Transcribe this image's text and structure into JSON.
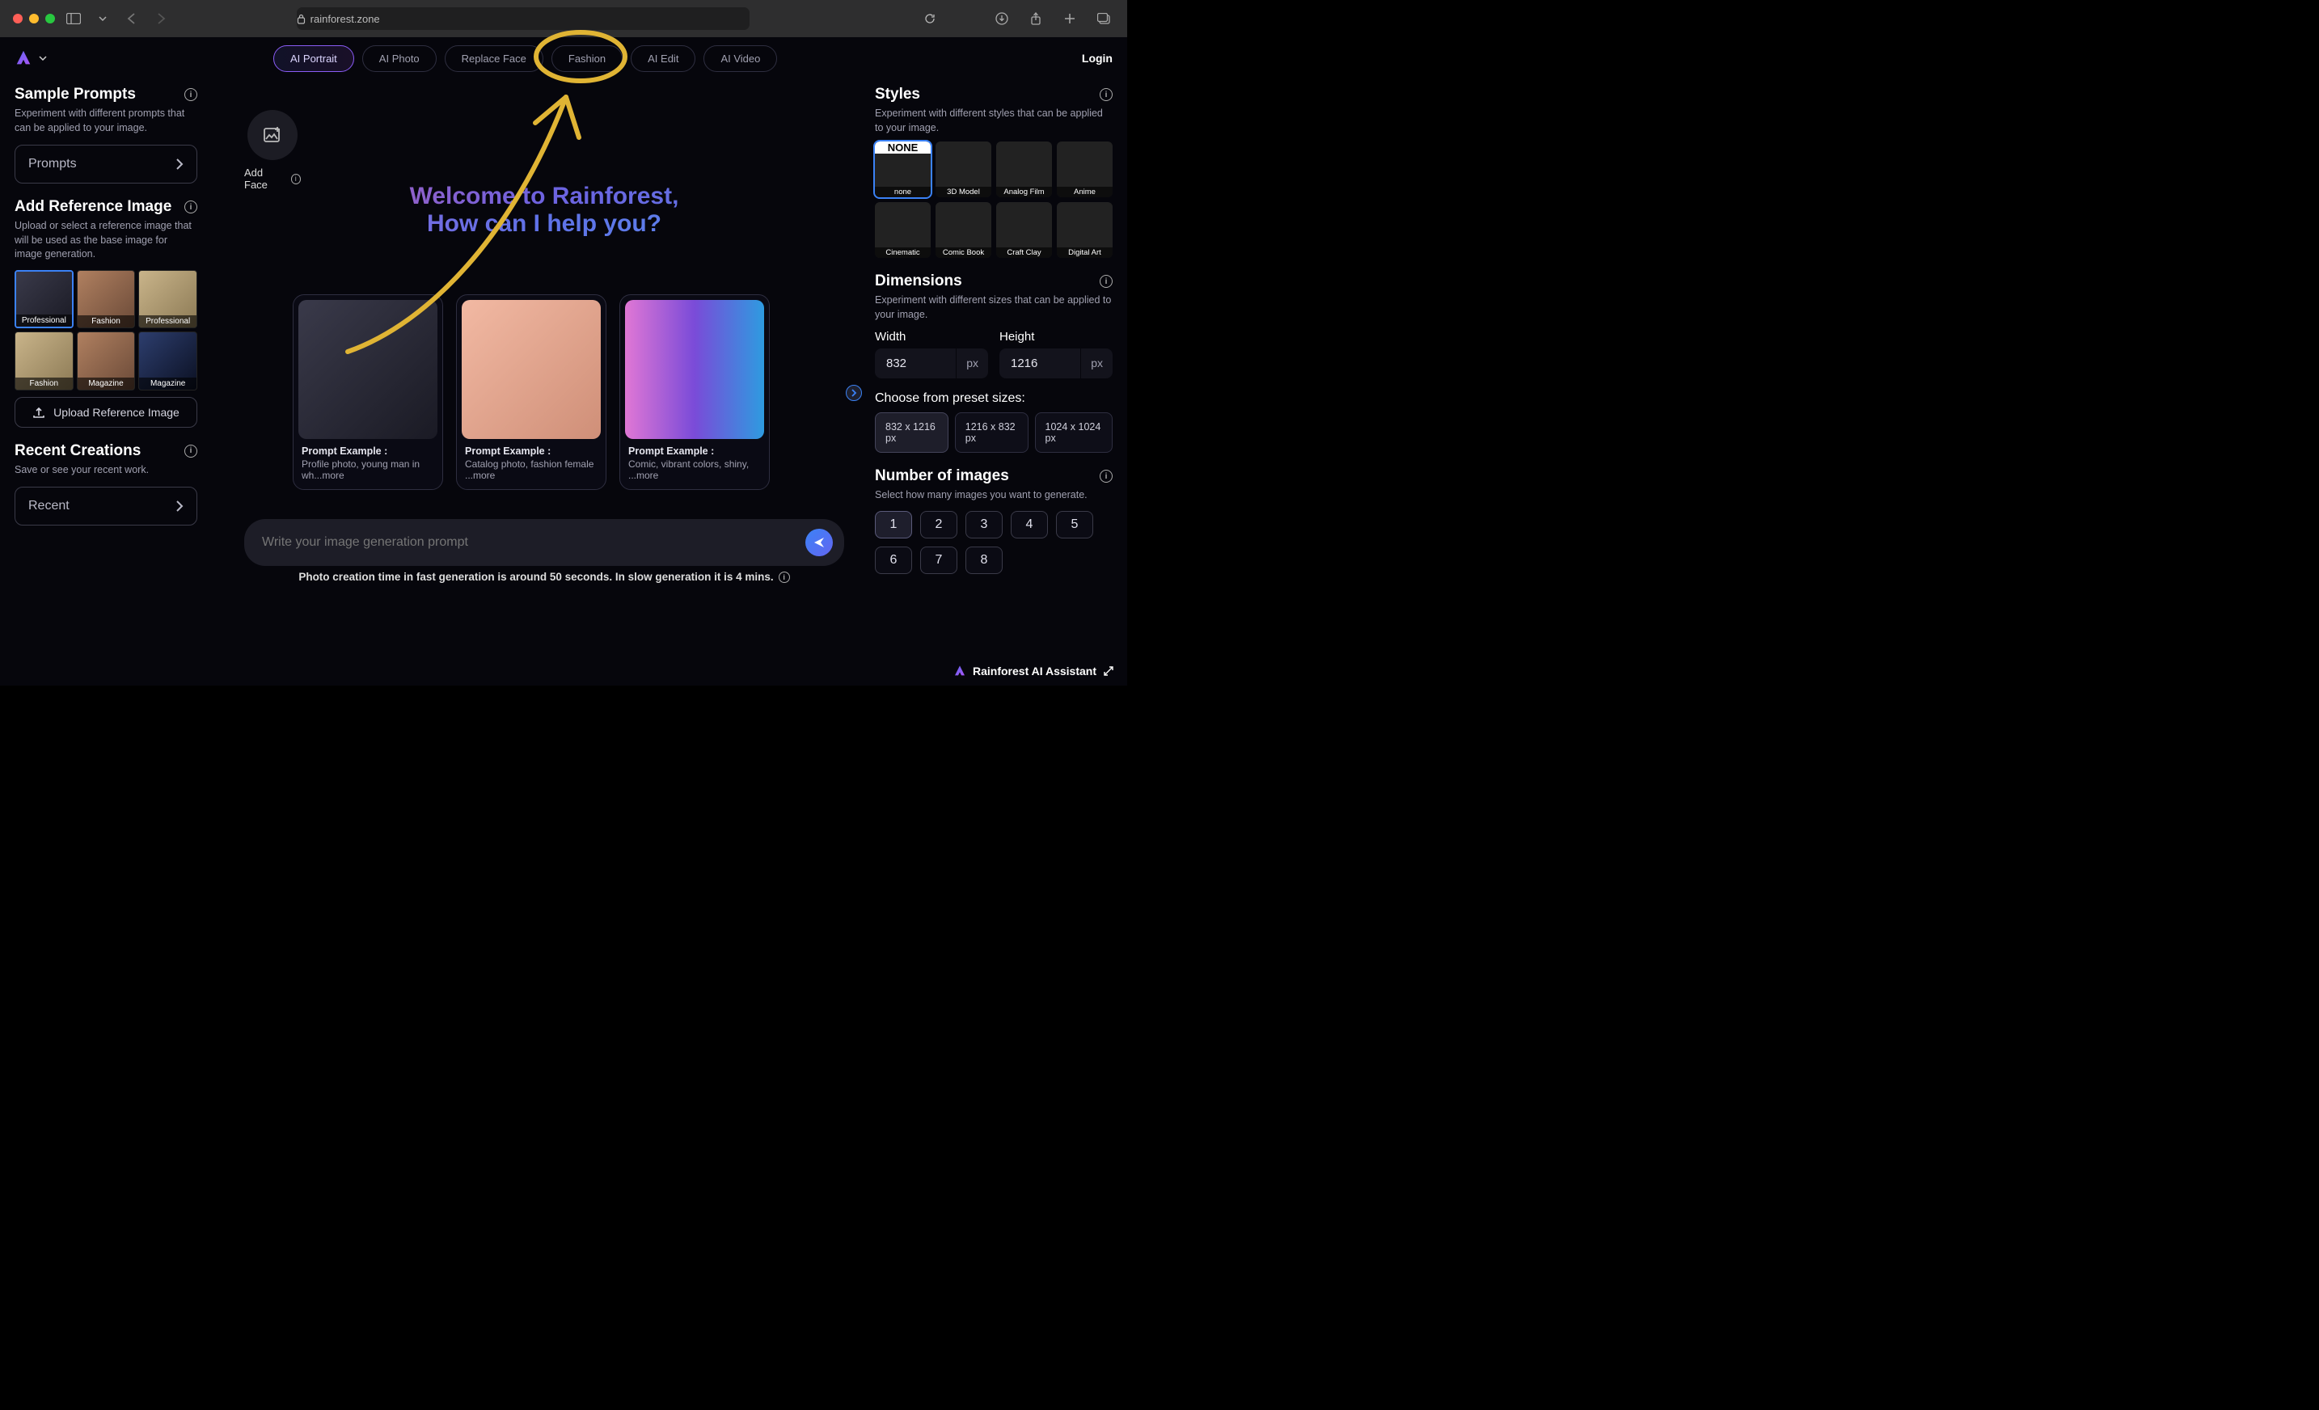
{
  "browser": {
    "url_host": "rainforest.zone"
  },
  "nav": {
    "items": [
      "AI Portrait",
      "AI Photo",
      "Replace Face",
      "Fashion",
      "AI Edit",
      "AI Video"
    ],
    "login": "Login"
  },
  "left": {
    "sample_title": "Sample Prompts",
    "sample_sub": "Experiment with different prompts that can be applied to your image.",
    "prompts_btn": "Prompts",
    "ref_title": "Add Reference Image",
    "ref_sub": "Upload or select a reference image that will be used as the base image for image generation.",
    "ref_images": [
      {
        "label": "Professional"
      },
      {
        "label": "Fashion"
      },
      {
        "label": "Professional"
      },
      {
        "label": "Fashion"
      },
      {
        "label": "Magazine"
      },
      {
        "label": "Magazine"
      }
    ],
    "upload_btn": "Upload Reference Image",
    "recent_title": "Recent Creations",
    "recent_sub": "Save or see your recent work.",
    "recent_btn": "Recent"
  },
  "center": {
    "add_face": "Add Face",
    "hero_line1": "Welcome to Rainforest,",
    "hero_line2": "How can I help you?",
    "cards": [
      {
        "title": "Prompt Example :",
        "desc": "Profile photo, young man in wh...more"
      },
      {
        "title": "Prompt Example :",
        "desc": "Catalog photo, fashion female ...more"
      },
      {
        "title": "Prompt Example :",
        "desc": "Comic, vibrant colors, shiny, ...more"
      }
    ],
    "prompt_placeholder": "Write your image generation prompt",
    "timing": "Photo creation time in fast generation is around 50 seconds. In slow generation it is 4 mins."
  },
  "right": {
    "styles_title": "Styles",
    "styles_sub": "Experiment with different styles that can be applied to your image.",
    "styles": [
      {
        "label": "none",
        "none": true
      },
      {
        "label": "3D Model"
      },
      {
        "label": "Analog Film"
      },
      {
        "label": "Anime"
      },
      {
        "label": "Cinematic"
      },
      {
        "label": "Comic Book"
      },
      {
        "label": "Craft Clay"
      },
      {
        "label": "Digital Art"
      }
    ],
    "dim_title": "Dimensions",
    "dim_sub": "Experiment with different sizes that can be applied to your image.",
    "width_label": "Width",
    "height_label": "Height",
    "width_val": "832",
    "height_val": "1216",
    "px": "px",
    "preset_label": "Choose from preset sizes:",
    "presets": [
      "832 x 1216 px",
      "1216 x 832 px",
      "1024 x 1024 px"
    ],
    "num_title": "Number of images",
    "num_sub": "Select how many images you want to generate.",
    "numbers": [
      "1",
      "2",
      "3",
      "4",
      "5",
      "6",
      "7",
      "8"
    ]
  },
  "assistant": {
    "label": "Rainforest AI Assistant"
  }
}
